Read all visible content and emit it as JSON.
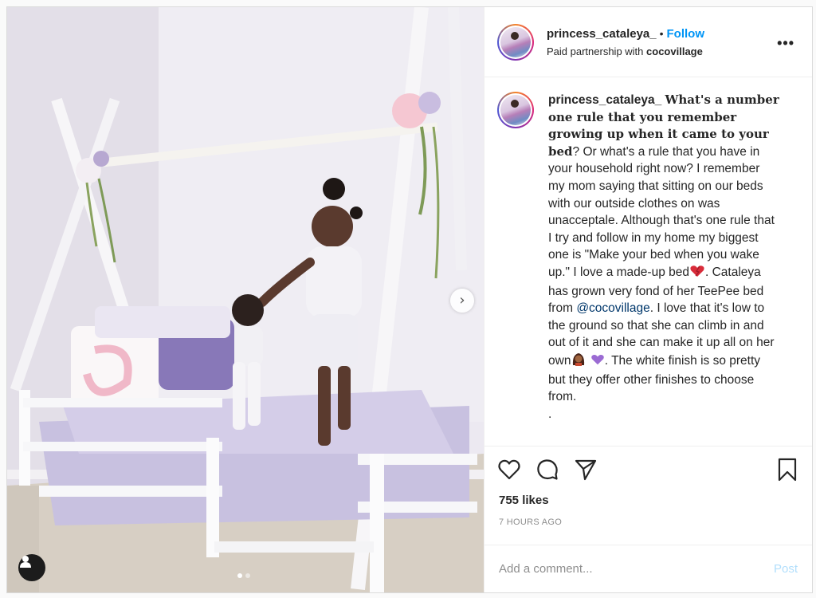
{
  "header": {
    "username": "princess_cataleya_",
    "separator": "•",
    "follow_label": "Follow",
    "partnership_prefix": "Paid partnership with",
    "partner": "cocovillage",
    "more_icon": "more-horizontal-icon"
  },
  "caption": {
    "username": "princess_cataleya_",
    "bold_lead": "What's a number one rule that you remember growing up when it came to your bed",
    "part1": "? Or what's a rule that you have in your household right now? I remember my mom saying that sitting on our beds with our outside clothes on was unacceptale. Although that's one rule that I try and follow in my home my biggest one is \"Make your bed when you wake up.\" I love a made-up bed",
    "part2": ". Cataleya has grown very fond of her TeePee bed from ",
    "mention": "@cocovillage",
    "part3": ". I love that it's low to the ground so that she can climb in and out of it and she can make it up all on her own",
    "part4": ". The white finish is so pretty but they offer other finishes to choose from.",
    "trailing": "."
  },
  "actions": {
    "like_icon": "heart-icon",
    "comment_icon": "comment-icon",
    "share_icon": "paper-plane-icon",
    "save_icon": "bookmark-icon"
  },
  "likes": "755 likes",
  "timestamp": "7 HOURS AGO",
  "comment_box": {
    "placeholder": "Add a comment...",
    "post_label": "Post"
  },
  "media": {
    "next_icon": "chevron-right-icon",
    "tag_icon": "user-tag-icon",
    "carousel_total": 2,
    "carousel_active": 1
  },
  "colors": {
    "accent": "#0095f6",
    "post_disabled": "#b2dffc",
    "muted": "#8e8e8e"
  }
}
